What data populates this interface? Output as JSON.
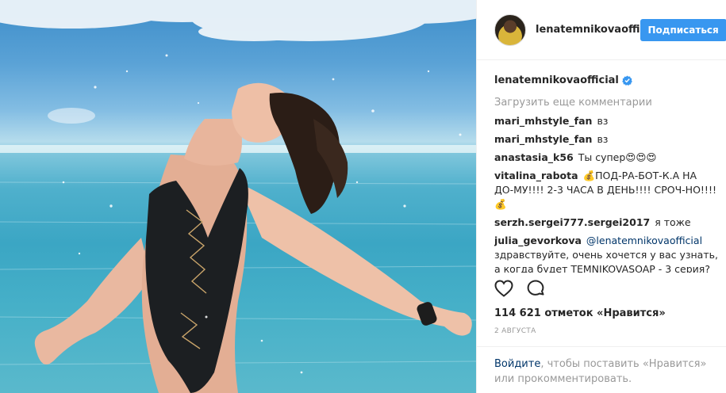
{
  "header": {
    "username": "lenatemnikovaoffi",
    "follow_label": "Подписаться"
  },
  "caption": {
    "username": "lenatemnikovaofficial"
  },
  "load_more_label": "Загрузить еще комментарии",
  "comments": [
    {
      "user": "mari_mhstyle_fan",
      "text": "вз"
    },
    {
      "user": "mari_mhstyle_fan",
      "text": "вз"
    },
    {
      "user": "anastasia_k56",
      "text": "Ты супер😍😍😍"
    },
    {
      "user": "vitalina_rabota",
      "text": "💰ПОД-РА-БОТ-К.А  НА ДО-МУ!!!! 2-3 ЧАСА В ДЕНЬ!!!! СРОЧ-НО!!!!💰"
    },
    {
      "user": "serzh.sergei777.sergei2017",
      "text": "я тоже"
    },
    {
      "user": "julia_gevorkova",
      "mention": "@lenatemnikovaofficial",
      "text": "здравствуйте, очень хочется у вас узнать, а когда будет TEMNIKOVASOAP - 3 серия?"
    }
  ],
  "likes_label": "114 621 отметок «Нравится»",
  "date_label": "2 АВГУСТА",
  "login_prompt": {
    "link": "Войдите",
    "text": ", чтобы поставить «Нравится» или прокомментировать."
  },
  "colors": {
    "accent": "#3897f0",
    "link": "#003569",
    "muted": "#999999"
  },
  "icons": [
    "heart-icon",
    "comment-icon",
    "verified-badge-icon"
  ]
}
